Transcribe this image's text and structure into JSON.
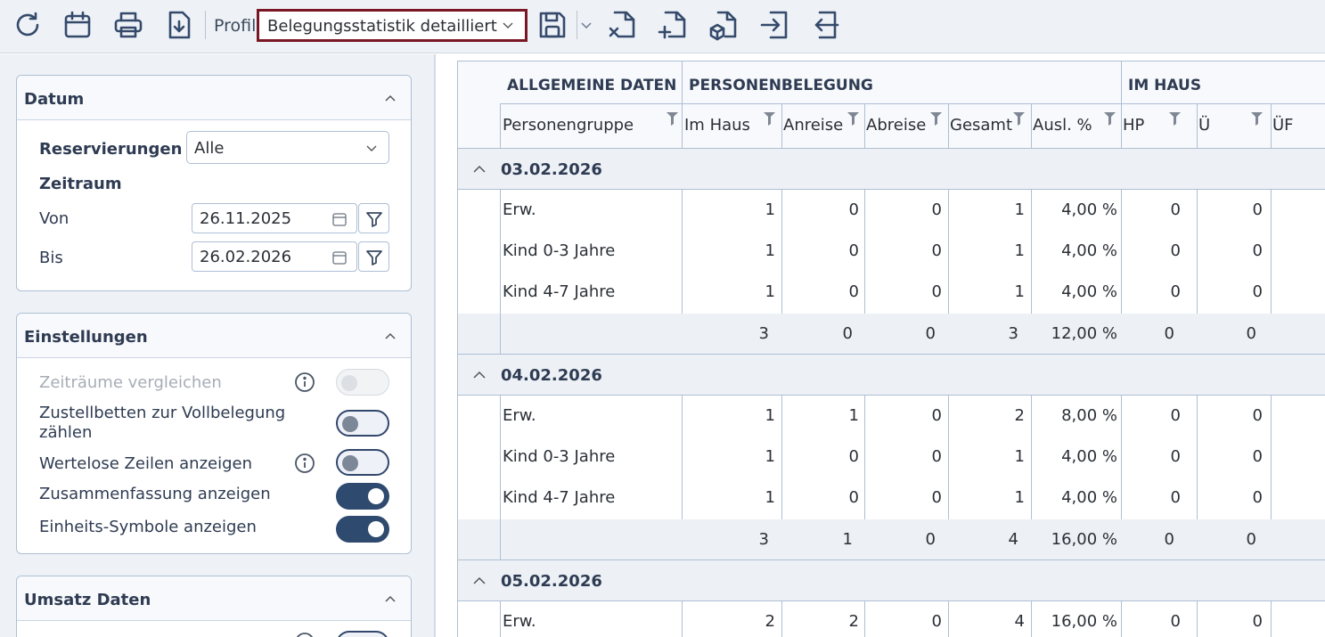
{
  "toolbar": {
    "profil_label": "Profil",
    "profile_value": "Belegungsstatistik detailliert",
    "icons": [
      "refresh-icon",
      "calendar-icon",
      "print-icon",
      "download-icon",
      "save-icon",
      "export-x-icon",
      "add-file-icon",
      "package-file-icon",
      "import-icon",
      "export-icon"
    ]
  },
  "datum": {
    "title": "Datum",
    "reservierungen_label": "Reservierungen :",
    "reservierungen_value": "Alle",
    "zeitraum_label": "Zeitraum",
    "von_label": "Von",
    "von_value": "26.11.2025",
    "bis_label": "Bis",
    "bis_value": "26.02.2026"
  },
  "einstellungen": {
    "title": "Einstellungen",
    "items": [
      {
        "label": "Zeiträume vergleichen",
        "state": "disabled",
        "info": true
      },
      {
        "label": "Zustellbetten zur Vollbelegung zählen",
        "state": "off",
        "info": false
      },
      {
        "label": "Wertelose Zeilen anzeigen",
        "state": "off",
        "info": true
      },
      {
        "label": "Zusammenfassung anzeigen",
        "state": "on",
        "info": false
      },
      {
        "label": "Einheits-Symbole anzeigen",
        "state": "on",
        "info": false
      }
    ]
  },
  "umsatz": {
    "title": "Umsatz Daten"
  },
  "table": {
    "group_headers": [
      "ALLGEMEINE DATEN",
      "PERSONENBELEGUNG",
      "IM HAUS"
    ],
    "columns": [
      "Personengruppe",
      "Im Haus",
      "Anreise",
      "Abreise",
      "Gesamt",
      "Ausl. %",
      "HP",
      "Ü",
      "ÜF"
    ],
    "groups": [
      {
        "date": "03.02.2026",
        "rows": [
          [
            "Erw.",
            "1",
            "0",
            "0",
            "1",
            "4,00 %",
            "0",
            "0"
          ],
          [
            "Kind 0-3 Jahre",
            "1",
            "0",
            "0",
            "1",
            "4,00 %",
            "0",
            "0"
          ],
          [
            "Kind 4-7 Jahre",
            "1",
            "0",
            "0",
            "1",
            "4,00 %",
            "0",
            "0"
          ]
        ],
        "total": [
          "",
          "3",
          "0",
          "0",
          "3",
          "12,00 %",
          "0",
          "0"
        ]
      },
      {
        "date": "04.02.2026",
        "rows": [
          [
            "Erw.",
            "1",
            "1",
            "0",
            "2",
            "8,00 %",
            "0",
            "0"
          ],
          [
            "Kind 0-3 Jahre",
            "1",
            "0",
            "0",
            "1",
            "4,00 %",
            "0",
            "0"
          ],
          [
            "Kind 4-7 Jahre",
            "1",
            "0",
            "0",
            "1",
            "4,00 %",
            "0",
            "0"
          ]
        ],
        "total": [
          "",
          "3",
          "1",
          "0",
          "4",
          "16,00 %",
          "0",
          "0"
        ]
      },
      {
        "date": "05.02.2026",
        "rows": [
          [
            "Erw.",
            "2",
            "2",
            "0",
            "4",
            "16,00 %",
            "0",
            "0"
          ]
        ],
        "total": null
      }
    ]
  }
}
